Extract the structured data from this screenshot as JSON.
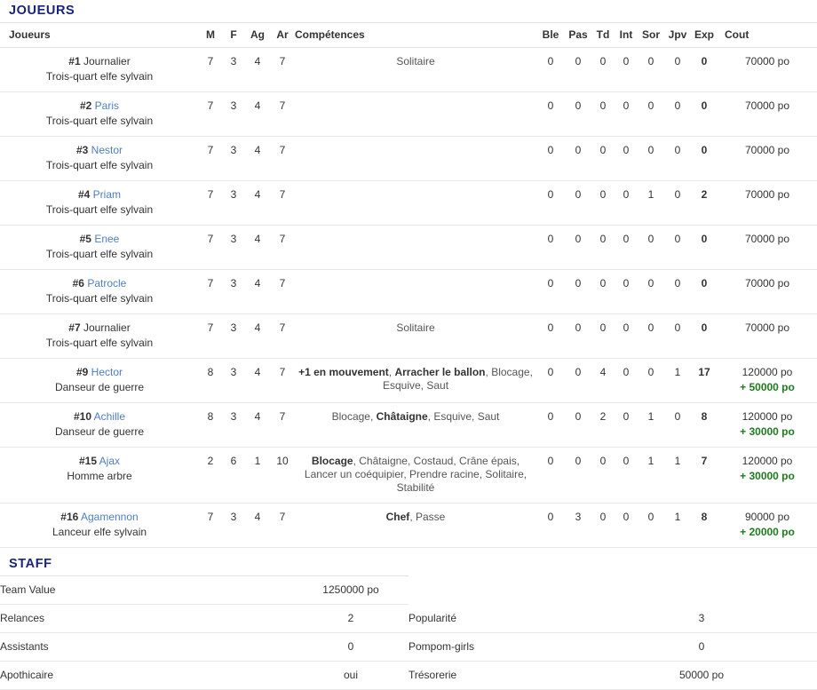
{
  "players_section": {
    "heading": "JOUEURS",
    "columns": {
      "name": "Joueurs",
      "m": "M",
      "f": "F",
      "ag": "Ag",
      "ar": "Ar",
      "skills": "Compétences",
      "ble": "Ble",
      "pas": "Pas",
      "td": "Td",
      "int": "Int",
      "sor": "Sor",
      "jpv": "Jpv",
      "exp": "Exp",
      "cout": "Cout"
    },
    "rows": [
      {
        "number": "#1",
        "name": "Journalier",
        "is_link": false,
        "role": "Trois-quart elfe sylvain",
        "m": "7",
        "f": "3",
        "ag": "4",
        "ar": "7",
        "skills": [
          {
            "text": "Solitaire",
            "bold": false
          }
        ],
        "ble": "0",
        "pas": "0",
        "td": "0",
        "int": "0",
        "sor": "0",
        "jpv": "0",
        "exp": "0",
        "cost": "70000 po",
        "cost_bonus": ""
      },
      {
        "number": "#2",
        "name": "Paris",
        "is_link": true,
        "role": "Trois-quart elfe sylvain",
        "m": "7",
        "f": "3",
        "ag": "4",
        "ar": "7",
        "skills": [],
        "ble": "0",
        "pas": "0",
        "td": "0",
        "int": "0",
        "sor": "0",
        "jpv": "0",
        "exp": "0",
        "cost": "70000 po",
        "cost_bonus": ""
      },
      {
        "number": "#3",
        "name": "Nestor",
        "is_link": true,
        "role": "Trois-quart elfe sylvain",
        "m": "7",
        "f": "3",
        "ag": "4",
        "ar": "7",
        "skills": [],
        "ble": "0",
        "pas": "0",
        "td": "0",
        "int": "0",
        "sor": "0",
        "jpv": "0",
        "exp": "0",
        "cost": "70000 po",
        "cost_bonus": ""
      },
      {
        "number": "#4",
        "name": "Priam",
        "is_link": true,
        "role": "Trois-quart elfe sylvain",
        "m": "7",
        "f": "3",
        "ag": "4",
        "ar": "7",
        "skills": [],
        "ble": "0",
        "pas": "0",
        "td": "0",
        "int": "0",
        "sor": "1",
        "jpv": "0",
        "exp": "2",
        "cost": "70000 po",
        "cost_bonus": ""
      },
      {
        "number": "#5",
        "name": "Enee",
        "is_link": true,
        "role": "Trois-quart elfe sylvain",
        "m": "7",
        "f": "3",
        "ag": "4",
        "ar": "7",
        "skills": [],
        "ble": "0",
        "pas": "0",
        "td": "0",
        "int": "0",
        "sor": "0",
        "jpv": "0",
        "exp": "0",
        "cost": "70000 po",
        "cost_bonus": ""
      },
      {
        "number": "#6",
        "name": "Patrocle",
        "is_link": true,
        "role": "Trois-quart elfe sylvain",
        "m": "7",
        "f": "3",
        "ag": "4",
        "ar": "7",
        "skills": [],
        "ble": "0",
        "pas": "0",
        "td": "0",
        "int": "0",
        "sor": "0",
        "jpv": "0",
        "exp": "0",
        "cost": "70000 po",
        "cost_bonus": ""
      },
      {
        "number": "#7",
        "name": "Journalier",
        "is_link": false,
        "role": "Trois-quart elfe sylvain",
        "m": "7",
        "f": "3",
        "ag": "4",
        "ar": "7",
        "skills": [
          {
            "text": "Solitaire",
            "bold": false
          }
        ],
        "ble": "0",
        "pas": "0",
        "td": "0",
        "int": "0",
        "sor": "0",
        "jpv": "0",
        "exp": "0",
        "cost": "70000 po",
        "cost_bonus": ""
      },
      {
        "number": "#9",
        "name": "Hector",
        "is_link": true,
        "role": "Danseur de guerre",
        "m": "8",
        "f": "3",
        "ag": "4",
        "ar": "7",
        "skills": [
          {
            "text": "+1 en mouvement",
            "bold": true
          },
          {
            "text": "Arracher le ballon",
            "bold": true
          },
          {
            "text": "Blocage",
            "bold": false
          },
          {
            "text": "Esquive",
            "bold": false
          },
          {
            "text": "Saut",
            "bold": false
          }
        ],
        "ble": "0",
        "pas": "0",
        "td": "4",
        "int": "0",
        "sor": "0",
        "jpv": "1",
        "exp": "17",
        "cost": "120000 po",
        "cost_bonus": "+ 50000 po"
      },
      {
        "number": "#10",
        "name": "Achille",
        "is_link": true,
        "role": "Danseur de guerre",
        "m": "8",
        "f": "3",
        "ag": "4",
        "ar": "7",
        "skills": [
          {
            "text": "Blocage",
            "bold": false
          },
          {
            "text": "Châtaigne",
            "bold": true
          },
          {
            "text": "Esquive",
            "bold": false
          },
          {
            "text": "Saut",
            "bold": false
          }
        ],
        "ble": "0",
        "pas": "0",
        "td": "2",
        "int": "0",
        "sor": "1",
        "jpv": "0",
        "exp": "8",
        "cost": "120000 po",
        "cost_bonus": "+ 30000 po"
      },
      {
        "number": "#15",
        "name": "Ajax",
        "is_link": true,
        "role": "Homme arbre",
        "m": "2",
        "f": "6",
        "ag": "1",
        "ar": "10",
        "skills": [
          {
            "text": "Blocage",
            "bold": true
          },
          {
            "text": "Châtaigne",
            "bold": false
          },
          {
            "text": "Costaud",
            "bold": false
          },
          {
            "text": "Crâne épais",
            "bold": false
          },
          {
            "text": "Lancer un coéquipier",
            "bold": false
          },
          {
            "text": "Prendre racine",
            "bold": false
          },
          {
            "text": "Solitaire",
            "bold": false
          },
          {
            "text": "Stabilité",
            "bold": false
          }
        ],
        "ble": "0",
        "pas": "0",
        "td": "0",
        "int": "0",
        "sor": "1",
        "jpv": "1",
        "exp": "7",
        "cost": "120000 po",
        "cost_bonus": "+ 30000 po"
      },
      {
        "number": "#16",
        "name": "Agamennon",
        "is_link": true,
        "role": "Lanceur elfe sylvain",
        "m": "7",
        "f": "3",
        "ag": "4",
        "ar": "7",
        "skills": [
          {
            "text": "Chef",
            "bold": true
          },
          {
            "text": "Passe",
            "bold": false
          }
        ],
        "ble": "0",
        "pas": "3",
        "td": "0",
        "int": "0",
        "sor": "0",
        "jpv": "1",
        "exp": "8",
        "cost": "90000 po",
        "cost_bonus": "+ 20000 po"
      }
    ]
  },
  "staff_section": {
    "heading": "STAFF",
    "rows": [
      {
        "label_a": "Team Value",
        "value_a": "1250000 po",
        "label_b": "",
        "value_b": ""
      },
      {
        "label_a": "Relances",
        "value_a": "2",
        "label_b": "Popularité",
        "value_b": "3"
      },
      {
        "label_a": "Assistants",
        "value_a": "0",
        "label_b": "Pompom-girls",
        "value_b": "0"
      },
      {
        "label_a": "Apothicaire",
        "value_a": "oui",
        "label_b": "Trésorerie",
        "value_b": "50000 po"
      }
    ]
  },
  "colors": {
    "heading": "#1a237e",
    "link": "#4d7fbf",
    "bonus_green": "#1f7a1f",
    "text": "#333333",
    "rule": "#e8e8e8"
  }
}
